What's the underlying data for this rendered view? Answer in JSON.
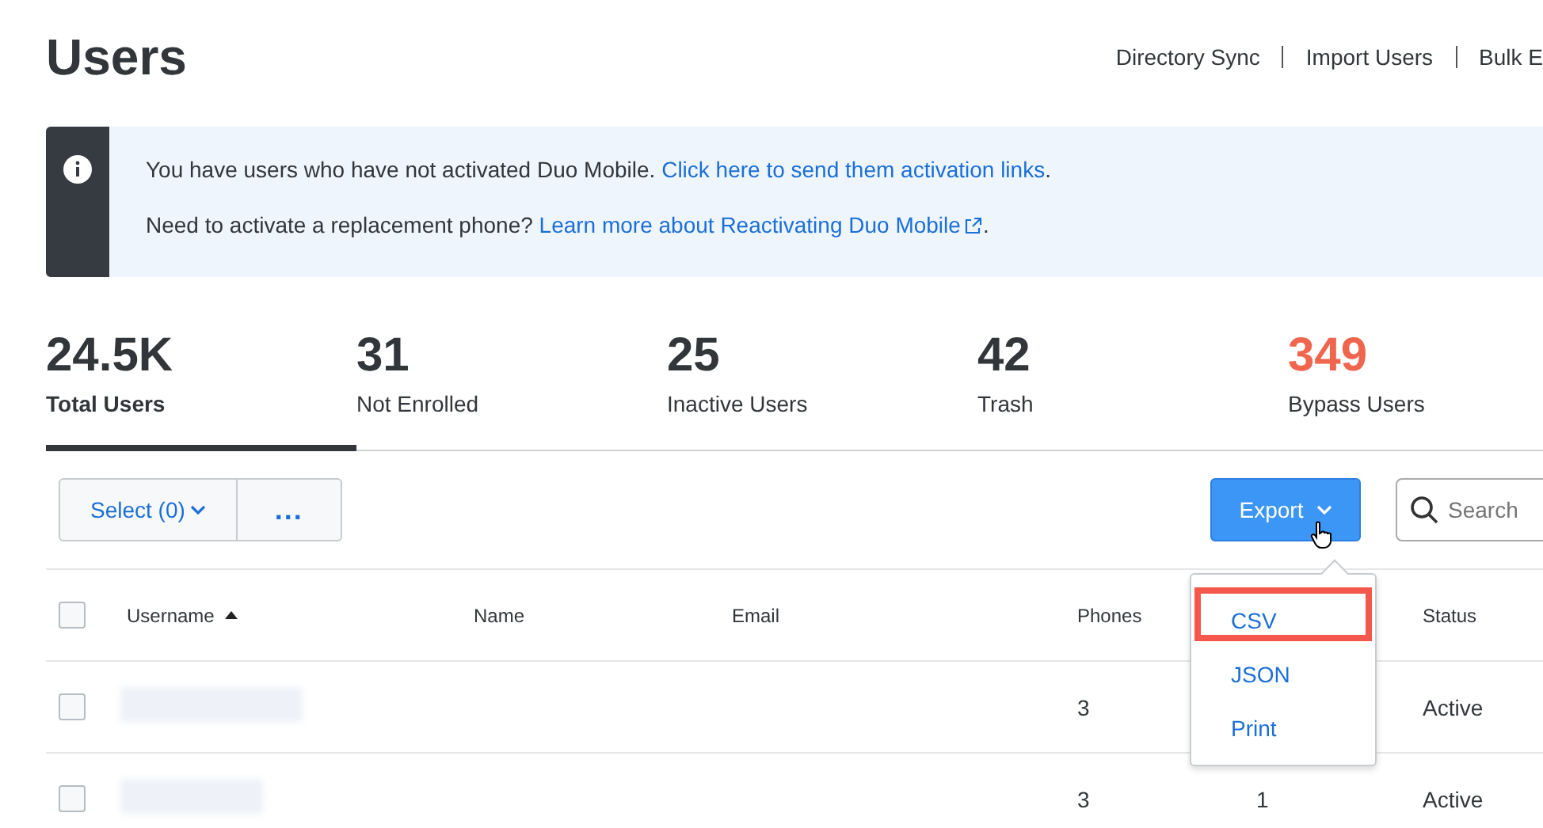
{
  "page": {
    "title": "Users"
  },
  "header_links": [
    {
      "label": "Directory Sync"
    },
    {
      "label": "Import Users"
    },
    {
      "label": "Bulk E"
    }
  ],
  "banner": {
    "lines": [
      {
        "text": "You have users who have not activated Duo Mobile. ",
        "link": "Click here to send them activation links",
        "external": false,
        "end": "."
      },
      {
        "text": "Need to activate a replacement phone? ",
        "link": "Learn more about Reactivating Duo Mobile",
        "external": true,
        "end": "."
      }
    ]
  },
  "stats": [
    {
      "count": "24.5K",
      "label": "Total Users",
      "selected": true,
      "color": "#32363b"
    },
    {
      "count": "31",
      "label": "Not Enrolled",
      "selected": false,
      "color": "#32363b"
    },
    {
      "count": "25",
      "label": "Inactive Users",
      "selected": false,
      "color": "#32363b"
    },
    {
      "count": "42",
      "label": "Trash",
      "selected": false,
      "color": "#32363b"
    },
    {
      "count": "349",
      "label": "Bypass Users",
      "selected": false,
      "color": "#f0654d"
    }
  ],
  "toolbar": {
    "select_button": "Select (0)",
    "more_button": "...",
    "export_button": "Export",
    "search": {
      "placeholder": "Search"
    }
  },
  "export_menu": {
    "expanded": true,
    "items": [
      {
        "label": "CSV",
        "highlighted": true
      },
      {
        "label": "JSON",
        "highlighted": false
      },
      {
        "label": "Print",
        "highlighted": false
      }
    ]
  },
  "table": {
    "select_all_checked": false,
    "columns": [
      {
        "label": "Username",
        "sorted": true
      },
      {
        "label": "Name",
        "sorted": false
      },
      {
        "label": "Email",
        "sorted": false
      },
      {
        "label": "Phones",
        "sorted": false
      },
      {
        "label": "Status",
        "sorted": false
      }
    ],
    "rows": [
      {
        "checked": false,
        "phones": "3",
        "status": "Active"
      },
      {
        "checked": false,
        "phones": "3",
        "column_5": "1",
        "status": "Active"
      }
    ]
  }
}
